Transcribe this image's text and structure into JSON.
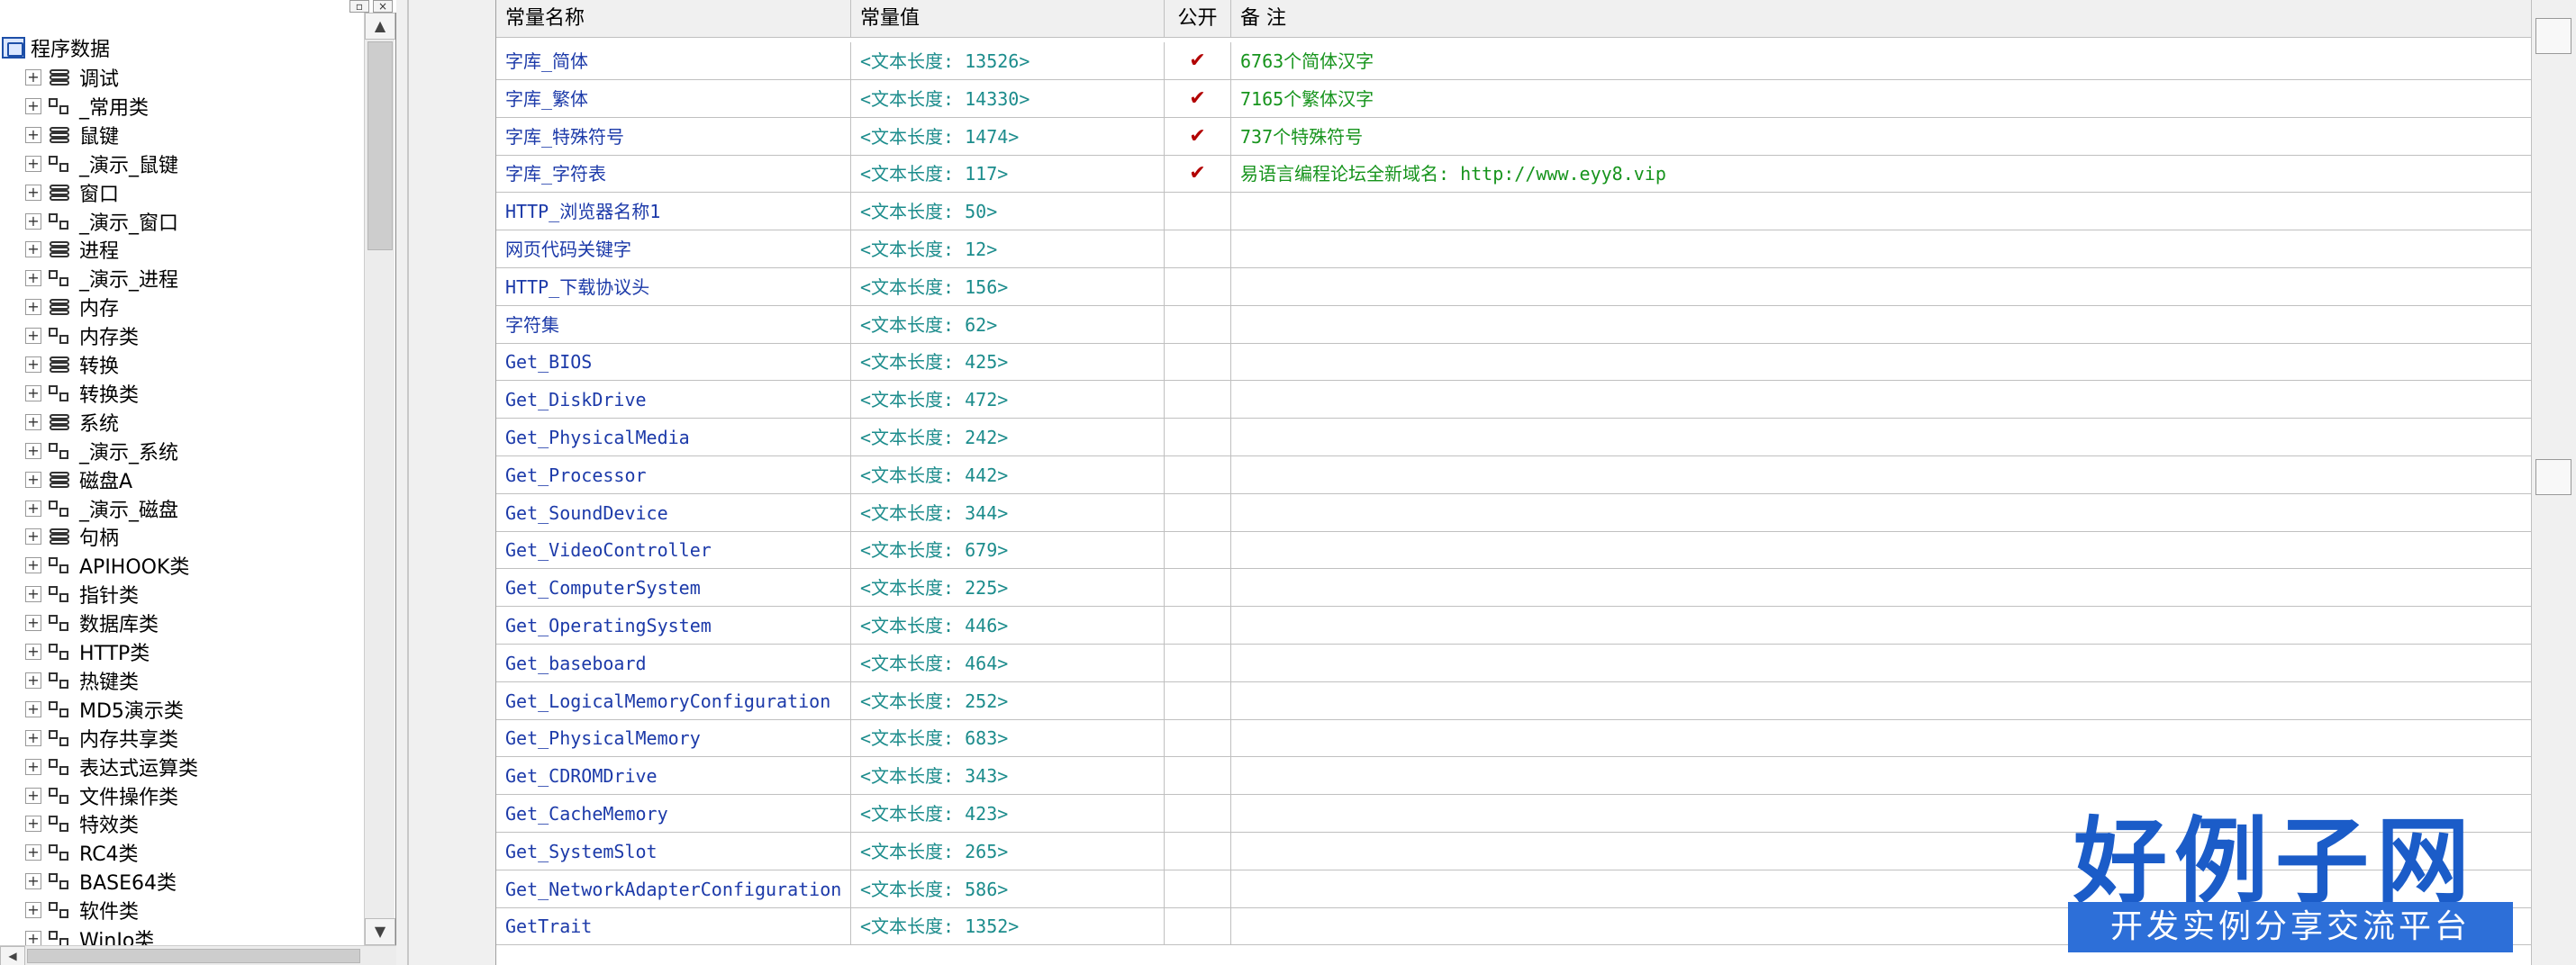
{
  "tree": {
    "root_label": "程序数据",
    "items": [
      {
        "label": "调试",
        "kind": "module"
      },
      {
        "label": "_常用类",
        "kind": "class"
      },
      {
        "label": "鼠键",
        "kind": "module"
      },
      {
        "label": "_演示_鼠键",
        "kind": "class"
      },
      {
        "label": "窗口",
        "kind": "module"
      },
      {
        "label": "_演示_窗口",
        "kind": "class"
      },
      {
        "label": "进程",
        "kind": "module"
      },
      {
        "label": "_演示_进程",
        "kind": "class"
      },
      {
        "label": "内存",
        "kind": "module"
      },
      {
        "label": "内存类",
        "kind": "class"
      },
      {
        "label": "转换",
        "kind": "module"
      },
      {
        "label": "转换类",
        "kind": "class"
      },
      {
        "label": "系统",
        "kind": "module"
      },
      {
        "label": "_演示_系统",
        "kind": "class"
      },
      {
        "label": "磁盘A",
        "kind": "module"
      },
      {
        "label": "_演示_磁盘",
        "kind": "class"
      },
      {
        "label": "句柄",
        "kind": "module"
      },
      {
        "label": "APIHOOK类",
        "kind": "class"
      },
      {
        "label": "指针类",
        "kind": "class"
      },
      {
        "label": "数据库类",
        "kind": "class"
      },
      {
        "label": "HTTP类",
        "kind": "class"
      },
      {
        "label": "热键类",
        "kind": "class"
      },
      {
        "label": "MD5演示类",
        "kind": "class"
      },
      {
        "label": "内存共享类",
        "kind": "class"
      },
      {
        "label": "表达式运算类",
        "kind": "class"
      },
      {
        "label": "文件操作类",
        "kind": "class"
      },
      {
        "label": "特效类",
        "kind": "class"
      },
      {
        "label": "RC4类",
        "kind": "class"
      },
      {
        "label": "BASE64类",
        "kind": "class"
      },
      {
        "label": "软件类",
        "kind": "class"
      },
      {
        "label": "WinIo类",
        "kind": "class"
      }
    ]
  },
  "table": {
    "headers": {
      "name": "常量名称",
      "value": "常量值",
      "public": "公开",
      "note": "备 注"
    },
    "rows": [
      {
        "name": "字库_简体",
        "value": "<文本长度: 13526>",
        "public": "✔",
        "note": "6763个简体汉字"
      },
      {
        "name": "字库_繁体",
        "value": "<文本长度: 14330>",
        "public": "✔",
        "note": "7165个繁体汉字"
      },
      {
        "name": "字库_特殊符号",
        "value": "<文本长度: 1474>",
        "public": "✔",
        "note": "737个特殊符号"
      },
      {
        "name": "字库_字符表",
        "value": "<文本长度: 117>",
        "public": "✔",
        "note": "易语言编程论坛全新域名: http://www.eyy8.vip"
      },
      {
        "name": "HTTP_浏览器名称1",
        "value": "<文本长度: 50>",
        "public": "",
        "note": ""
      },
      {
        "name": "网页代码关键字",
        "value": "<文本长度: 12>",
        "public": "",
        "note": ""
      },
      {
        "name": "HTTP_下载协议头",
        "value": "<文本长度: 156>",
        "public": "",
        "note": ""
      },
      {
        "name": "字符集",
        "value": "<文本长度: 62>",
        "public": "",
        "note": ""
      },
      {
        "name": "Get_BIOS",
        "value": "<文本长度: 425>",
        "public": "",
        "note": ""
      },
      {
        "name": "Get_DiskDrive",
        "value": "<文本长度: 472>",
        "public": "",
        "note": ""
      },
      {
        "name": "Get_PhysicalMedia",
        "value": "<文本长度: 242>",
        "public": "",
        "note": ""
      },
      {
        "name": "Get_Processor",
        "value": "<文本长度: 442>",
        "public": "",
        "note": ""
      },
      {
        "name": "Get_SoundDevice",
        "value": "<文本长度: 344>",
        "public": "",
        "note": ""
      },
      {
        "name": "Get_VideoController",
        "value": "<文本长度: 679>",
        "public": "",
        "note": ""
      },
      {
        "name": "Get_ComputerSystem",
        "value": "<文本长度: 225>",
        "public": "",
        "note": ""
      },
      {
        "name": "Get_OperatingSystem",
        "value": "<文本长度: 446>",
        "public": "",
        "note": ""
      },
      {
        "name": "Get_baseboard",
        "value": "<文本长度: 464>",
        "public": "",
        "note": ""
      },
      {
        "name": "Get_LogicalMemoryConfiguration",
        "value": "<文本长度: 252>",
        "public": "",
        "note": ""
      },
      {
        "name": "Get_PhysicalMemory",
        "value": "<文本长度: 683>",
        "public": "",
        "note": ""
      },
      {
        "name": "Get_CDROMDrive",
        "value": "<文本长度: 343>",
        "public": "",
        "note": ""
      },
      {
        "name": "Get_CacheMemory",
        "value": "<文本长度: 423>",
        "public": "",
        "note": ""
      },
      {
        "name": "Get_SystemSlot",
        "value": "<文本长度: 265>",
        "public": "",
        "note": ""
      },
      {
        "name": "Get_NetworkAdapterConfiguration",
        "value": "<文本长度: 586>",
        "public": "",
        "note": ""
      },
      {
        "name": "GetTrait",
        "value": "<文本长度: 1352>",
        "public": "",
        "note": ""
      }
    ]
  },
  "logo": {
    "main": "好例子网",
    "sub": "开发实例分享交流平台"
  },
  "colors": {
    "name": "#1c3aa9",
    "value": "#1c8c8c",
    "note": "#17941d",
    "check": "#b20000",
    "logo": "#1b5cc8"
  }
}
